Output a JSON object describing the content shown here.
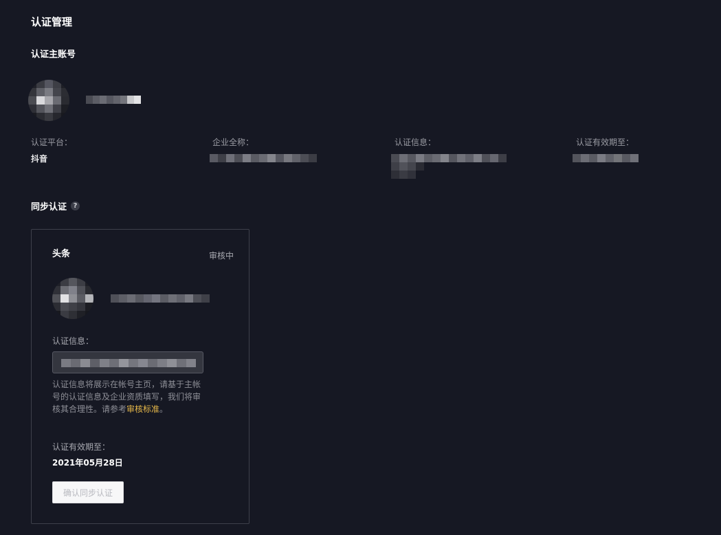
{
  "page": {
    "title": "认证管理"
  },
  "main_account": {
    "section_title": "认证主账号",
    "avatar_icon": "blurred-avatar",
    "fields": [
      {
        "label": "认证平台：",
        "value": "抖音"
      },
      {
        "label": "企业全称：",
        "value": ""
      },
      {
        "label": "认证信息：",
        "value": ""
      },
      {
        "label": "认证有效期至：",
        "value": ""
      }
    ]
  },
  "sync": {
    "section_title": "同步认证",
    "help_icon": "?",
    "card": {
      "platform": "头条",
      "status": "审核中",
      "info_label": "认证信息：",
      "hint_text": "认证信息将展示在帐号主页，请基于主帐号的认证信息及企业资质填写，我们将审核其合理性。请参考",
      "hint_link": "审核标准",
      "hint_end": "。",
      "expire_label": "认证有效期至：",
      "expire_date": "2021年05月28日",
      "confirm_button": "确认同步认证"
    }
  },
  "colors": {
    "background": "#161823",
    "link": "#e6b84a",
    "card_border": "#3e404b"
  }
}
